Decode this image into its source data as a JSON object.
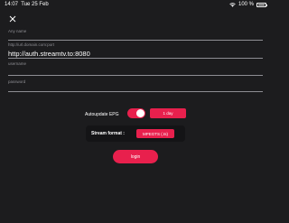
{
  "status_bar": {
    "time": "14:07",
    "date": "Tue 25 Feb",
    "battery": "100 %"
  },
  "form": {
    "name_placeholder": "Any name",
    "url_label": "http://url.domain.com:port",
    "url_value": "http://auth.streamtv.to:8080",
    "username_placeholder": "username",
    "password_placeholder": "password"
  },
  "epg": {
    "label": "Autoupdate EPG",
    "enabled": true,
    "interval": "1 day"
  },
  "stream": {
    "label": "Stream format :",
    "format": "MPEGTS (.ts)"
  },
  "login_label": "login",
  "colors": {
    "background": "#1c1c1e",
    "accent": "#e8204d",
    "line": "#8e8e93"
  }
}
